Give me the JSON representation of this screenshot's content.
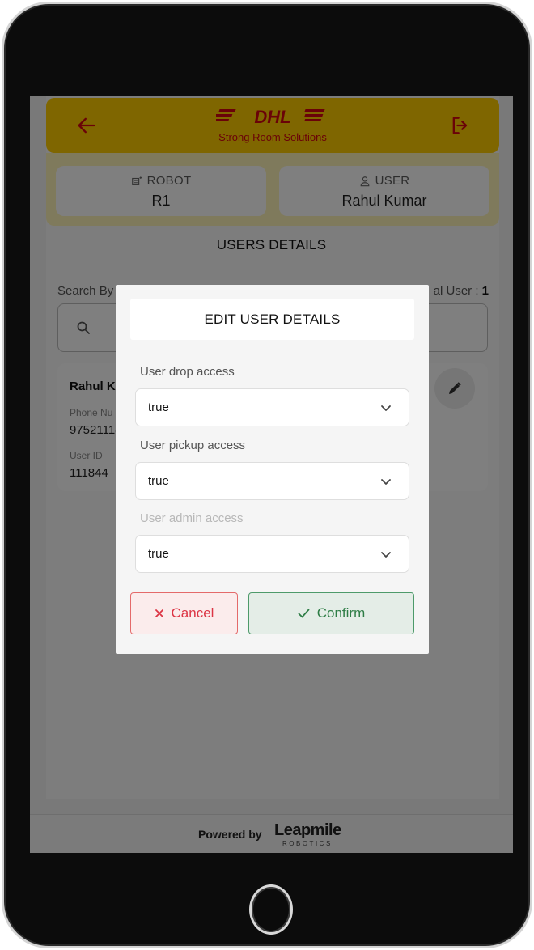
{
  "header": {
    "brand": "DHL",
    "subtitle": "Strong Room Solutions"
  },
  "info": {
    "robot_label": "ROBOT",
    "robot_value": "R1",
    "user_label": "USER",
    "user_value": "Rahul Kumar"
  },
  "page": {
    "section_title": "USERS DETAILS",
    "search_label": "Search By",
    "total_label": "al User : ",
    "total_value": "1"
  },
  "user_card": {
    "name": "Rahul K",
    "phone_label": "Phone Nu",
    "phone": "97521118",
    "id_label": "User ID",
    "id": "111844"
  },
  "modal": {
    "title": "EDIT USER DETAILS",
    "fields": [
      {
        "label": "User drop access",
        "value": "true",
        "disabled": false
      },
      {
        "label": "User pickup access",
        "value": "true",
        "disabled": false
      },
      {
        "label": "User admin access",
        "value": "true",
        "disabled": true
      }
    ],
    "cancel_label": "Cancel",
    "confirm_label": "Confirm"
  },
  "footer": {
    "powered_by": "Powered by",
    "company": "Leapmile",
    "company_sub": "ROBOTICS"
  },
  "colors": {
    "header_bg": "#ffcc00",
    "brand_red": "#d40511",
    "cancel": "#dc3545",
    "confirm": "#2e7d46"
  },
  "icons": [
    "back-arrow-icon",
    "logout-icon",
    "robot-icon",
    "user-icon",
    "search-icon",
    "pencil-icon",
    "chevron-down-icon",
    "close-icon",
    "check-icon"
  ]
}
